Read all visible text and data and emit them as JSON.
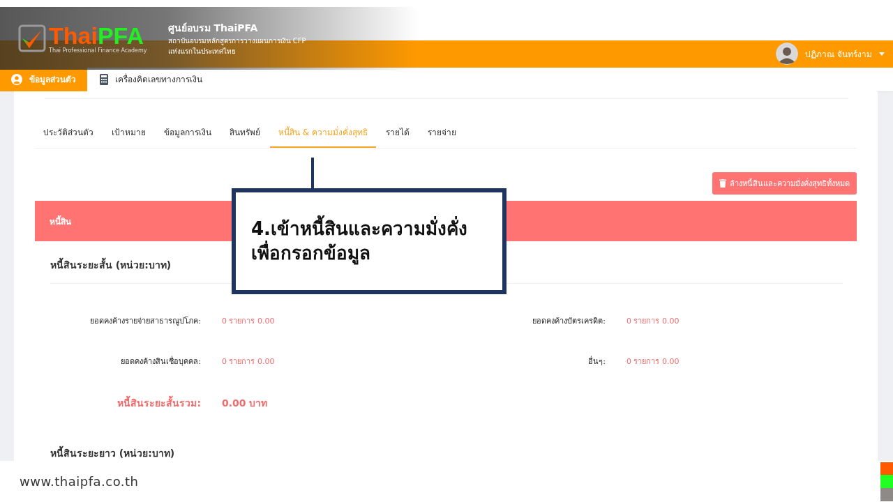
{
  "brand": {
    "logo_part_1": "Thai",
    "logo_part_2": "PFA",
    "logo_subtitle": "Thai Professional Finance Academy",
    "title": "ศูนย์อบรม ThaiPFA",
    "subtitle_lines": [
      "สถาบันอบรมหลักสูตรการวางแผนการเงิน CFP",
      "แห่งแรกในประเทศไทย"
    ]
  },
  "user": {
    "name": "ปฏิภาณ จันทร์งาม"
  },
  "nav": [
    {
      "label": "ข้อมูลส่วนตัว",
      "selected": true,
      "kind": "person"
    },
    {
      "label": "เครื่องคิดเลขทางการเงิน",
      "selected": false,
      "kind": "calculator"
    }
  ],
  "tabs": [
    {
      "label": "ประวัติส่วนตัว",
      "selected": false
    },
    {
      "label": "เป้าหมาย",
      "selected": false
    },
    {
      "label": "ข้อมูลการเงิน",
      "selected": false
    },
    {
      "label": "สินทรัพย์",
      "selected": false
    },
    {
      "label": "หนี้สิน & ความมั่งคั่งสุทธิ",
      "selected": true
    },
    {
      "label": "รายได้",
      "selected": false
    },
    {
      "label": "รายจ่าย",
      "selected": false
    }
  ],
  "clear_button": "ล้างหนี้สินและความมั่งคั่งสุทธิทั้งหมด",
  "section": {
    "title": "หนี้สิน",
    "short_term": {
      "heading": "หนี้สินระยะสั้น (หน่วย:บาท)",
      "fields": [
        {
          "label": "ยอดคงค้างรายจ่ายสาธารณูปโภค:",
          "value": "0 รายการ 0.00"
        },
        {
          "label": "ยอดคงค้างบัตรเครดิต:",
          "value": "0 รายการ 0.00"
        },
        {
          "label": "ยอดคงค้างสินเชื่อบุคคล:",
          "value": "0 รายการ 0.00"
        },
        {
          "label": "อื่นๆ:",
          "value": "0 รายการ 0.00"
        }
      ],
      "total_label": "หนี้สินระยะสั้นรวม:",
      "total_value": "0.00 บาท"
    },
    "long_term": {
      "heading": "หนี้สินระยะยาว (หน่วย:บาท)"
    }
  },
  "callout": {
    "lines": [
      "4.เข้าหนี้สินและความมั่งคั่ง",
      "เพื่อกรอกข้อมูล"
    ]
  },
  "footer": {
    "url": "www.thaipfa.co.th"
  }
}
